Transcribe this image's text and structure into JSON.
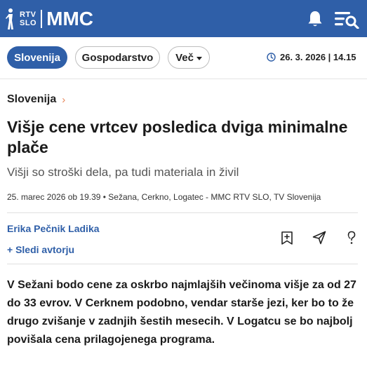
{
  "header": {
    "logo_rtv": "RTV",
    "logo_slo": "SLO",
    "logo_mmc": "MMC",
    "brand_color": "#2f5fa8",
    "icons": [
      "bell-icon",
      "menu-search-icon"
    ]
  },
  "nav": {
    "tabs": [
      {
        "label": "Slovenija",
        "active": true
      },
      {
        "label": "Gospodarstvo",
        "active": false
      },
      {
        "label": "Več",
        "active": false,
        "dropdown": true
      }
    ],
    "datetime": "26. 3. 2026 | 14.15"
  },
  "article": {
    "breadcrumb": "Slovenija",
    "breadcrumb_arrow": "›",
    "title": "Višje cene vrtcev posledica dviga minimalne plače",
    "subtitle": "Višji so stroški dela, pa tudi materiala in živil",
    "meta": "25. marec 2026 ob 19.39 • Sežana, Cerkno, Logatec - MMC RTV SLO, TV Slovenija",
    "author": "Erika Pečnik Ladika",
    "follow_label": "+ Sledi avtorju",
    "actions": [
      "bookmark-add-icon",
      "share-icon",
      "question-icon"
    ],
    "lead": "V Sežani bodo cene za oskrbo najmlajših večinoma višje za od 27 do 33 evrov. V Cerknem podobno, vendar starše jezi, ker bo to že drugo zvišanje v zadnjih šestih mesecih. V Logatcu se bo najbolj povišala cena prilagojenega programa."
  }
}
